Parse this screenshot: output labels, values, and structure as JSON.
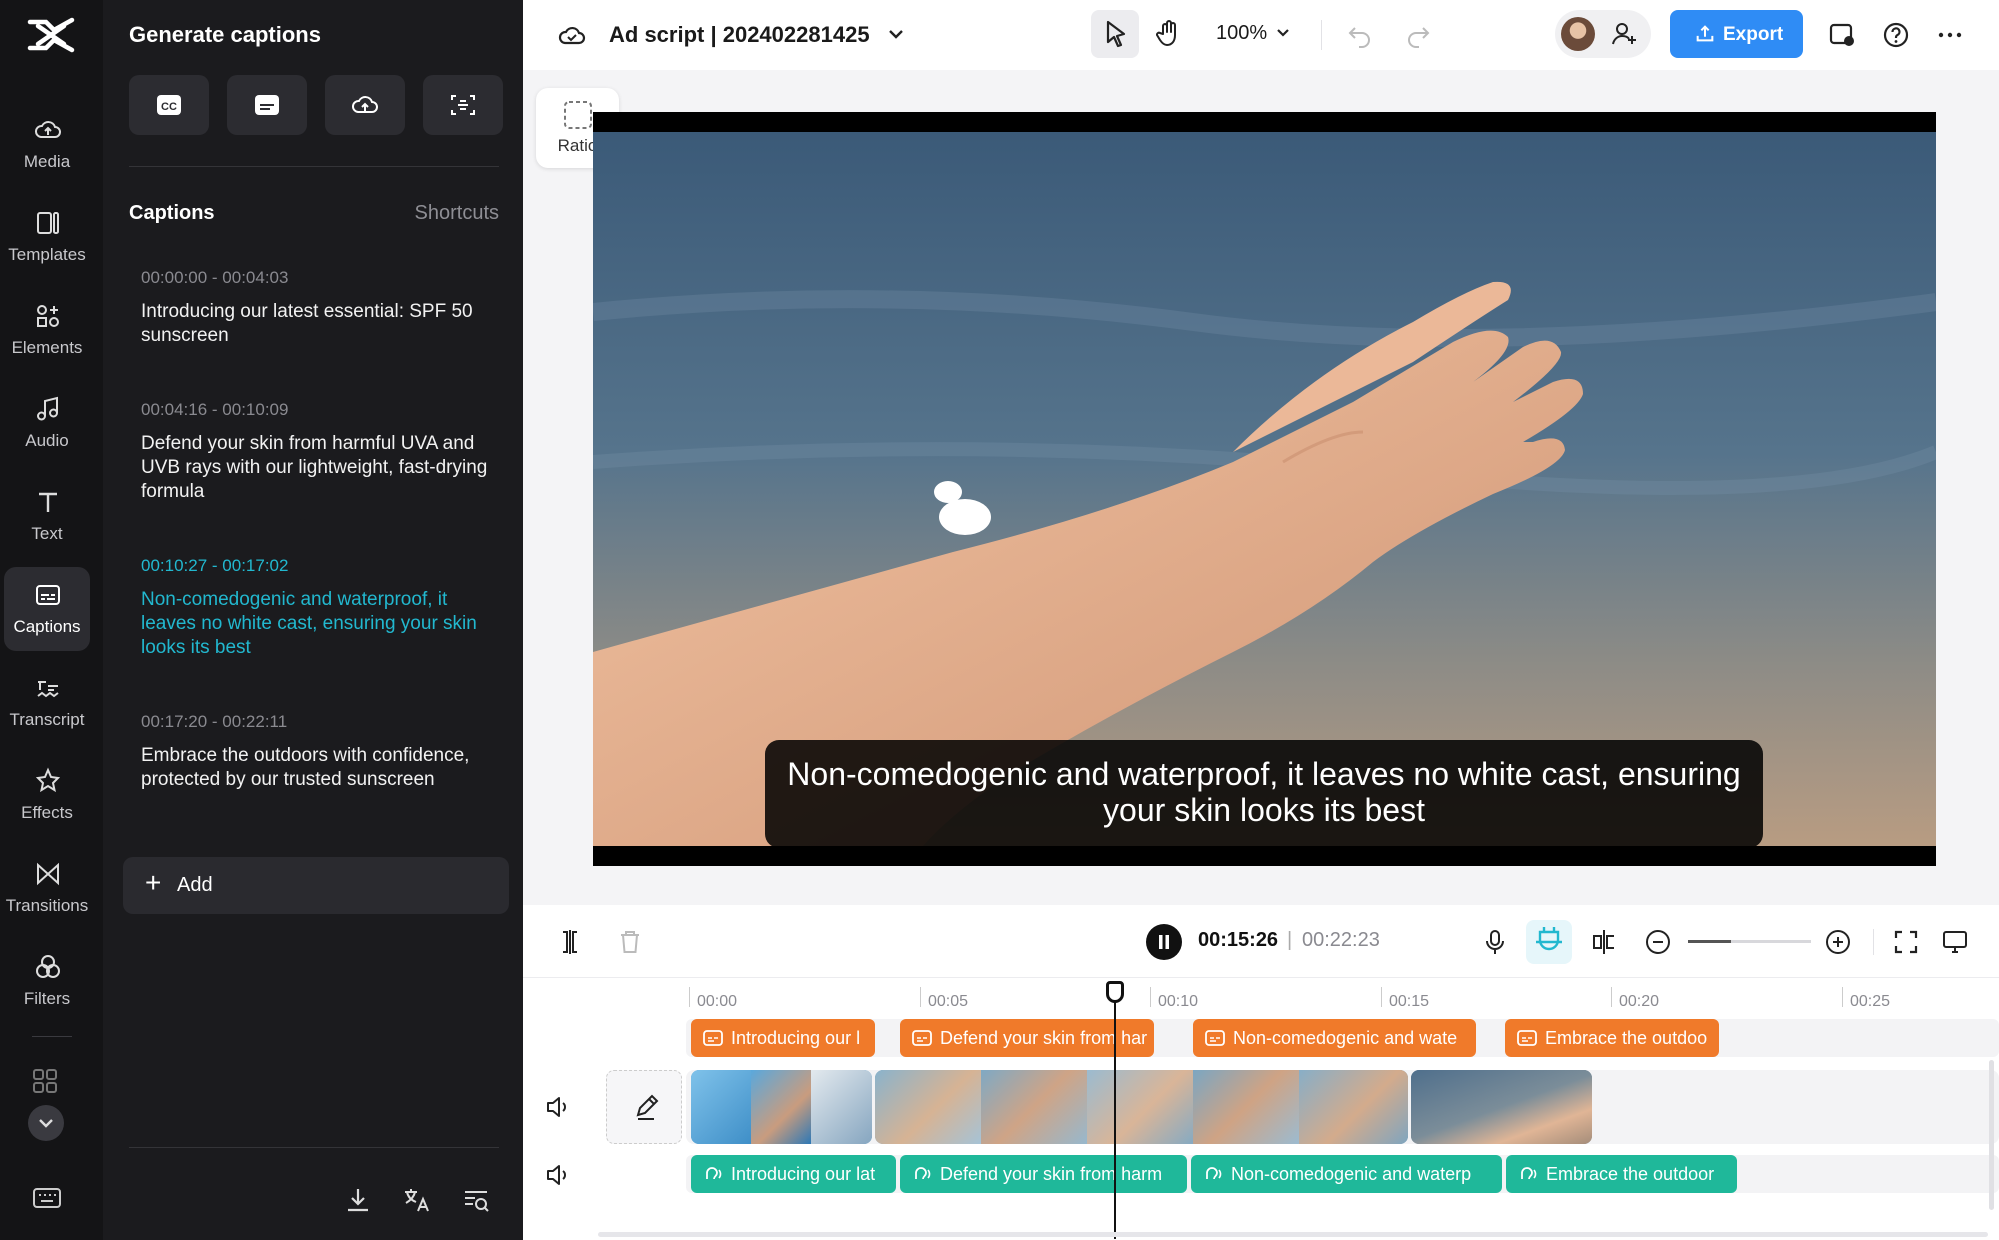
{
  "rail": {
    "items": [
      {
        "label": "Media",
        "icon": "cloud-media-icon"
      },
      {
        "label": "Templates",
        "icon": "templates-icon"
      },
      {
        "label": "Elements",
        "icon": "elements-icon"
      },
      {
        "label": "Audio",
        "icon": "music-note-icon"
      },
      {
        "label": "Text",
        "icon": "text-icon"
      },
      {
        "label": "Captions",
        "icon": "captions-icon",
        "active": true
      },
      {
        "label": "Transcript",
        "icon": "transcript-icon"
      },
      {
        "label": "Effects",
        "icon": "effects-icon"
      },
      {
        "label": "Transitions",
        "icon": "transitions-icon"
      },
      {
        "label": "Filters",
        "icon": "filters-icon"
      }
    ]
  },
  "panel": {
    "title": "Generate captions",
    "captions_heading": "Captions",
    "shortcuts_label": "Shortcuts",
    "captions": [
      {
        "time": "00:00:00 - 00:04:03",
        "text": "Introducing our latest essential: SPF 50 sunscreen"
      },
      {
        "time": "00:04:16 - 00:10:09",
        "text": "Defend your skin from harmful UVA and UVB rays with our lightweight, fast-drying formula"
      },
      {
        "time": "00:10:27 - 00:17:02",
        "text": "Non-comedogenic and waterproof, it leaves no white cast, ensuring your skin looks its best",
        "active": true
      },
      {
        "time": "00:17:20 - 00:22:11",
        "text": "Embrace the outdoors with confidence, protected by our trusted sunscreen"
      }
    ],
    "add_label": "Add"
  },
  "topbar": {
    "project_name": "Ad script | 202402281425",
    "zoom": "100%",
    "export_label": "Export"
  },
  "canvas": {
    "ratio_label": "Ratio",
    "subtitle_text": "Non-comedogenic and waterproof, it leaves no white cast, ensuring your skin looks its best"
  },
  "timeline": {
    "current_time": "00:15:26",
    "separator": "|",
    "total_time": "00:22:23",
    "zoom_level": 0.35,
    "ruler": [
      "00:00",
      "00:05",
      "00:10",
      "00:15",
      "00:20",
      "00:25"
    ],
    "caption_clips": [
      "Introducing our l",
      "Defend your skin from har",
      "Non-comedogenic and wate",
      "Embrace the outdoo"
    ],
    "audio_clips": [
      "Introducing our lat",
      "Defend your skin from harm",
      "Non-comedogenic and waterp",
      "Embrace the outdoor"
    ]
  },
  "colors": {
    "accent": "#2f8cf5",
    "caption_active": "#22b8cf",
    "caption_clip": "#f07a2a",
    "audio_clip": "#1fb89a"
  }
}
